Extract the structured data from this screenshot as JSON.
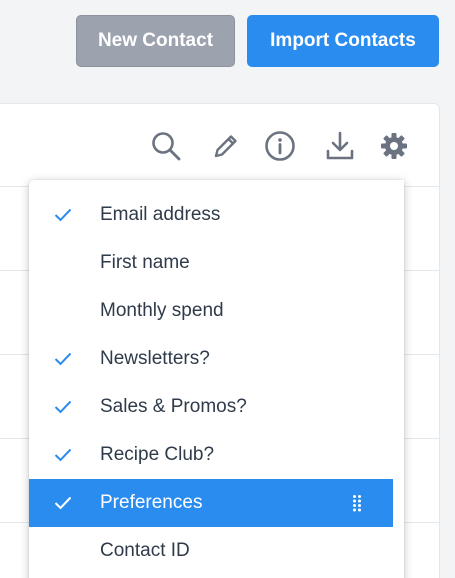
{
  "header": {
    "new_contact_label": "New Contact",
    "import_contacts_label": "Import Contacts"
  },
  "toolbar": {
    "icons": [
      "search-icon",
      "pencil-icon",
      "info-icon",
      "download-icon",
      "gear-icon"
    ]
  },
  "column_menu": {
    "items": [
      {
        "label": "Email address",
        "checked": true,
        "selected": false
      },
      {
        "label": "First name",
        "checked": false,
        "selected": false
      },
      {
        "label": "Monthly spend",
        "checked": false,
        "selected": false
      },
      {
        "label": "Newsletters?",
        "checked": true,
        "selected": false
      },
      {
        "label": "Sales & Promos?",
        "checked": true,
        "selected": false
      },
      {
        "label": "Recipe Club?",
        "checked": true,
        "selected": false
      },
      {
        "label": "Preferences",
        "checked": true,
        "selected": true
      },
      {
        "label": "Contact ID",
        "checked": false,
        "selected": false
      }
    ]
  },
  "colors": {
    "accent": "#2b8cf0",
    "secondary_button": "#9ca3af",
    "icon_gray": "#6b7280",
    "text": "#2f3b4a"
  }
}
